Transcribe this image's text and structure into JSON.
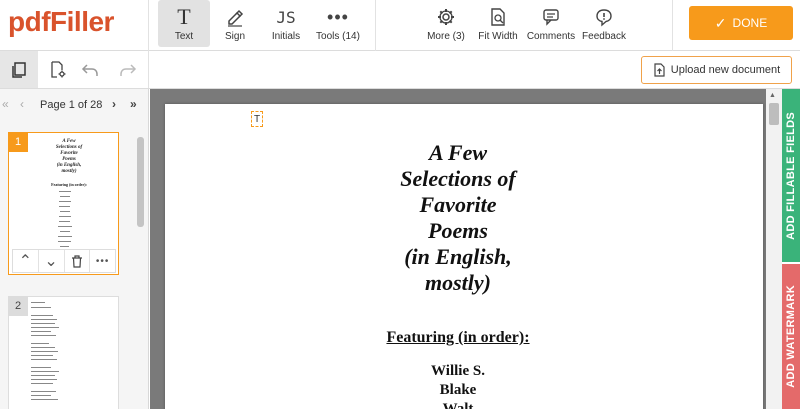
{
  "app": {
    "logo_prefix": "pdf",
    "logo_suffix": "Filler"
  },
  "toolbar": {
    "tools": [
      {
        "label": "Text"
      },
      {
        "label": "Sign"
      },
      {
        "label": "Initials"
      },
      {
        "label": "Tools (14)"
      },
      {
        "label": "More (3)"
      },
      {
        "label": "Fit Width"
      },
      {
        "label": "Comments"
      },
      {
        "label": "Feedback"
      }
    ],
    "done_label": "DONE",
    "accent": "#f79a1b"
  },
  "subbar": {
    "upload_label": "Upload new document"
  },
  "sidebar": {
    "page_indicator": "Page 1 of 28",
    "thumbnails": [
      {
        "number": "1",
        "title_lines": [
          "A Few",
          "Selections of",
          "Favorite",
          "Poems",
          "(in English,",
          "mostly)"
        ],
        "featuring": "Featuring (in order):"
      },
      {
        "number": "2"
      }
    ]
  },
  "document": {
    "marker": "T",
    "title_lines": [
      "A Few",
      "Selections of",
      "Favorite",
      "Poems",
      "(in English,",
      "mostly)"
    ],
    "featuring": "Featuring (in order):",
    "authors": [
      "Willie S.",
      "Blake",
      "Walt"
    ]
  },
  "right_tabs": {
    "fillable": "ADD FILLABLE FIELDS",
    "watermark": "ADD WATERMARK",
    "fillable_color": "#3ab37a",
    "watermark_color": "#e46a6a"
  }
}
